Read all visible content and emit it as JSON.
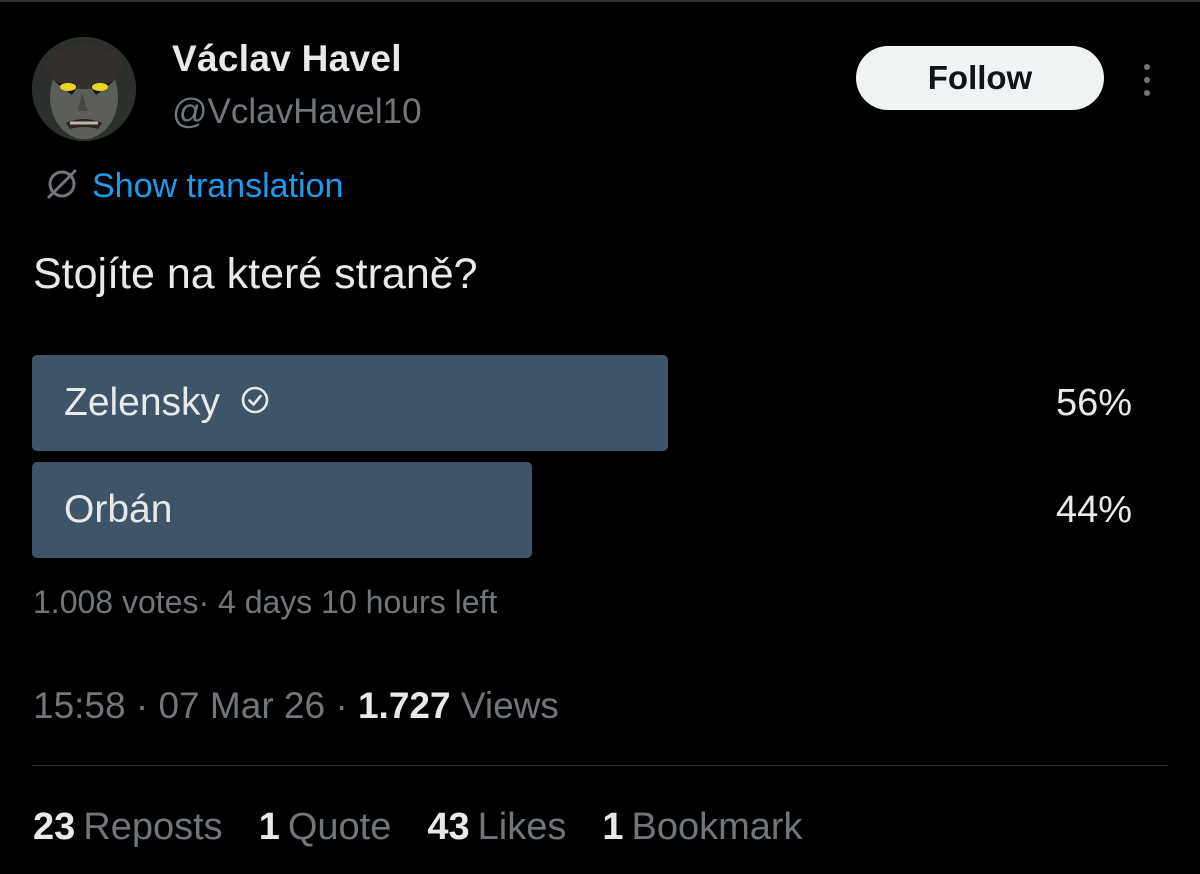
{
  "author": {
    "display_name": "Václav Havel",
    "handle": "@VclavHavel10"
  },
  "follow_label": "Follow",
  "translation_label": "Show translation",
  "tweet_text": "Stojíte na které straně?",
  "poll": {
    "options": [
      {
        "label": "Zelensky",
        "percent_text": "56%",
        "fill_fraction": 0.56,
        "selected": true
      },
      {
        "label": "Orbán",
        "percent_text": "44%",
        "fill_fraction": 0.44,
        "selected": false
      }
    ],
    "meta": "1.008 votes· 4 days 10 hours left"
  },
  "timestamp": {
    "time": "15:58",
    "date": "07 Mar 26",
    "views_count": "1.727",
    "views_label": "Views"
  },
  "stats": {
    "reposts": {
      "count": "23",
      "label": "Reposts"
    },
    "quotes": {
      "count": "1",
      "label": "Quote"
    },
    "likes": {
      "count": "43",
      "label": "Likes"
    },
    "bookmarks": {
      "count": "1",
      "label": "Bookmark"
    }
  },
  "colors": {
    "background": "#000000",
    "poll_fill": "#3f5567",
    "link_blue": "#1d9bf0",
    "muted_text": "#71767b",
    "primary_text": "#e7e9ea"
  },
  "icons": {
    "translate": "globe-slash-icon",
    "selected_option": "check-circle-icon",
    "more": "more-vertical-icon"
  }
}
